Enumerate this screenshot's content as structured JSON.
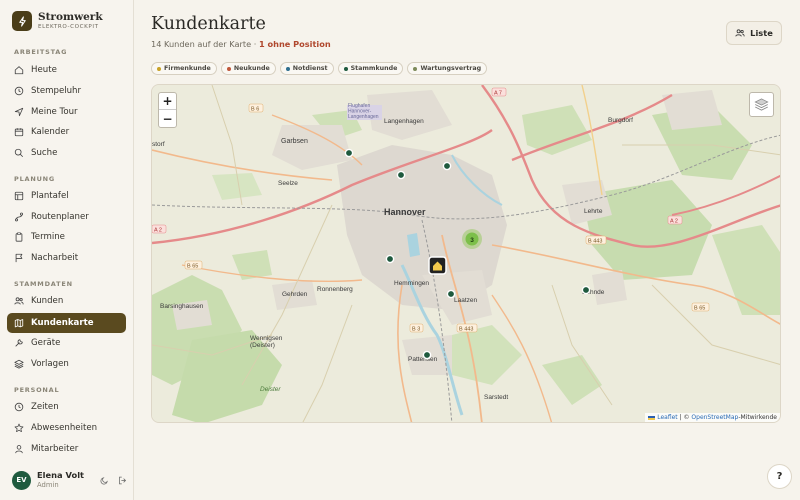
{
  "app": {
    "name": "Stromwerk",
    "subtitle": "ELEKTRO-COCKPIT"
  },
  "sidebar": {
    "sections": [
      {
        "label": "ARBEITSTAG",
        "items": [
          {
            "label": "Heute",
            "icon": "home-icon"
          },
          {
            "label": "Stempeluhr",
            "icon": "clock-icon"
          },
          {
            "label": "Meine Tour",
            "icon": "navigation-icon"
          },
          {
            "label": "Kalender",
            "icon": "calendar-icon"
          },
          {
            "label": "Suche",
            "icon": "search-icon"
          }
        ]
      },
      {
        "label": "PLANUNG",
        "items": [
          {
            "label": "Plantafel",
            "icon": "board-icon"
          },
          {
            "label": "Routenplaner",
            "icon": "route-icon"
          },
          {
            "label": "Termine",
            "icon": "clipboard-icon"
          },
          {
            "label": "Nacharbeit",
            "icon": "flag-icon"
          }
        ]
      },
      {
        "label": "STAMMDATEN",
        "items": [
          {
            "label": "Kunden",
            "icon": "users-icon"
          },
          {
            "label": "Kundenkarte",
            "icon": "map-icon",
            "active": true
          },
          {
            "label": "Geräte",
            "icon": "wrench-icon"
          },
          {
            "label": "Vorlagen",
            "icon": "layers-icon"
          }
        ]
      },
      {
        "label": "PERSONAL",
        "items": [
          {
            "label": "Zeiten",
            "icon": "clock-icon"
          },
          {
            "label": "Abwesenheiten",
            "icon": "star-icon"
          },
          {
            "label": "Mitarbeiter",
            "icon": "user-icon"
          }
        ]
      }
    ]
  },
  "user": {
    "initials": "EV",
    "name": "Elena Volt",
    "role": "Admin"
  },
  "header": {
    "title": "Kundenkarte",
    "subtitle": "14 Kunden auf der Karte · ",
    "warning": "1 ohne Position",
    "list_button": "Liste"
  },
  "legend": [
    {
      "label": "Firmenkunde",
      "color": "#c9a227"
    },
    {
      "label": "Neukunde",
      "color": "#c0573a"
    },
    {
      "label": "Notdienst",
      "color": "#2f6f8f"
    },
    {
      "label": "Stammkunde",
      "color": "#1f5a3e"
    },
    {
      "label": "Wartungsvertrag",
      "color": "#7d8a5a"
    }
  ],
  "map": {
    "zoom_in": "+",
    "zoom_out": "−",
    "cluster_count": "3",
    "attribution_leaflet": "Leaflet",
    "attribution_sep": " | © ",
    "attribution_osm": "OpenStreetMap",
    "attribution_tail": "-Mitwirkende",
    "labels": {
      "hannover": "Hannover",
      "garbsen": "Garbsen",
      "langenhagen": "Langenhagen",
      "burgdorf": "Burgdorf",
      "seelze": "Seelze",
      "lehrte": "Lehrte",
      "hemmingen": "Hemmingen",
      "laatzen": "Laatzen",
      "gehrden": "Gehrden",
      "ronnenberg": "Ronnenberg",
      "barsinghausen": "Barsinghausen",
      "wennigsen": "Wennigsen\n(Deister)",
      "pattensen": "Pattensen",
      "sarstedt": "Sarstedt",
      "sehnde": "Sehnde",
      "deister": "Deister",
      "a7": "A 7",
      "a2w": "A 2",
      "a2e": "A 2",
      "b6": "B 6",
      "b65w": "B 65",
      "b65e": "B 65",
      "b443": "B 443",
      "b443b": "B 443",
      "b3": "B 3",
      "flughafen": "Flughafen\nHannover-\nLangenhagen",
      "storf": "storf"
    }
  },
  "help_button": "?"
}
